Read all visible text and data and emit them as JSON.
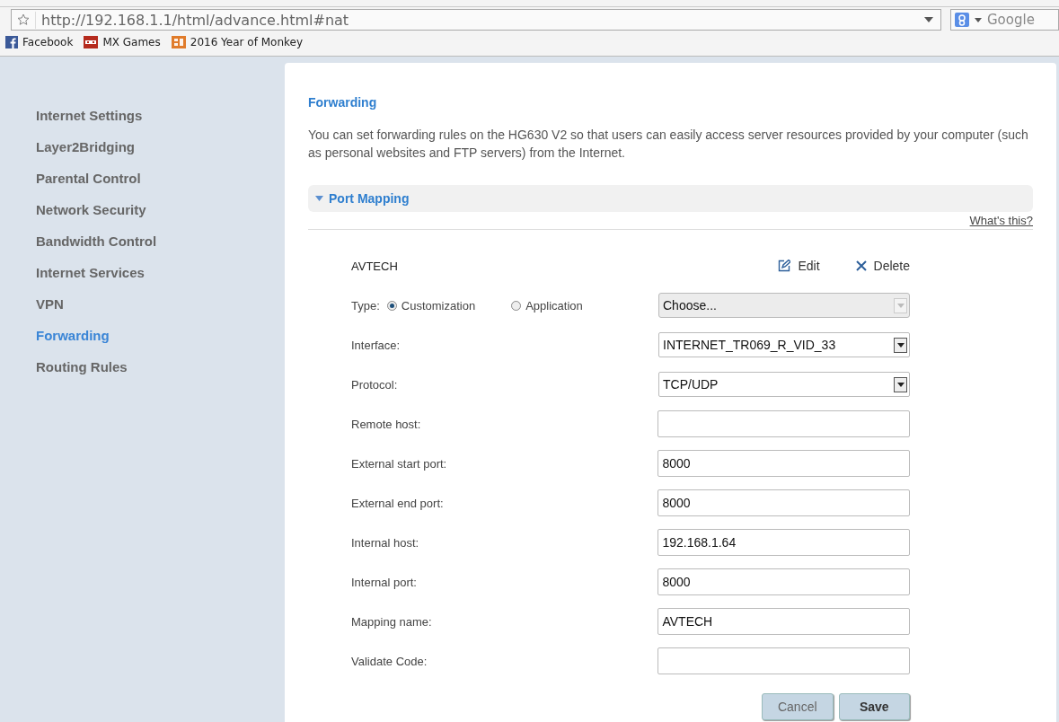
{
  "browser": {
    "url": "http://192.168.1.1/html/advance.html#nat",
    "search_placeholder": "Google",
    "bookmarks": [
      {
        "label": "Facebook",
        "kind": "fb"
      },
      {
        "label": "MX Games",
        "kind": "mx"
      },
      {
        "label": "2016 Year of Monkey",
        "kind": "bg"
      }
    ]
  },
  "sidebar": {
    "items": [
      {
        "label": "Internet Settings",
        "selected": false
      },
      {
        "label": "Layer2Bridging",
        "selected": false
      },
      {
        "label": "Parental Control",
        "selected": false
      },
      {
        "label": "Network Security",
        "selected": false
      },
      {
        "label": "Bandwidth Control",
        "selected": false
      },
      {
        "label": "Internet Services",
        "selected": false
      },
      {
        "label": "VPN",
        "selected": false
      },
      {
        "label": "Forwarding",
        "selected": true
      },
      {
        "label": "Routing Rules",
        "selected": false
      }
    ]
  },
  "content": {
    "title": "Forwarding",
    "description": "You can set forwarding rules on the HG630 V2 so that users can easily access server resources provided by your computer (such as personal websites and FTP servers) from the Internet.",
    "section": {
      "title": "Port Mapping",
      "expanded": true,
      "help_link": "What's this?"
    },
    "rule": {
      "name": "AVTECH",
      "actions": [
        "Edit",
        "Delete"
      ]
    },
    "type": {
      "label": "Type:",
      "options": [
        {
          "label": "Customization",
          "selected": true
        },
        {
          "label": "Application",
          "selected": false
        }
      ],
      "select": {
        "value": "Choose...",
        "disabled": true
      }
    },
    "fields": [
      {
        "label": "Interface:",
        "kind": "select",
        "value": "INTERNET_TR069_R_VID_33"
      },
      {
        "label": "Protocol:",
        "kind": "select",
        "value": "TCP/UDP"
      },
      {
        "label": "Remote host:",
        "kind": "input"
      },
      {
        "label": "External start port:",
        "kind": "input",
        "value": "8000"
      },
      {
        "label": "External end port:",
        "kind": "input",
        "value": "8000"
      },
      {
        "label": "Internal host:",
        "kind": "input",
        "value": "192.168.1.64"
      },
      {
        "label": "Internal port:",
        "kind": "input",
        "value": "8000"
      },
      {
        "label": "Mapping name:",
        "kind": "input",
        "value": "AVTECH"
      },
      {
        "label": "Validate Code:",
        "kind": "input"
      }
    ],
    "buttons": [
      {
        "label": "Cancel",
        "primary": false
      },
      {
        "label": "Save",
        "primary": true
      }
    ]
  }
}
